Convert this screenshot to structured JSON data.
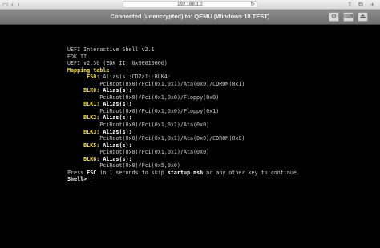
{
  "browser": {
    "url": "192.168.1.2",
    "icons": [
      "sidebar-icon",
      "back-icon",
      "forward-icon",
      "reload-icon",
      "share-icon",
      "tabs-icon"
    ]
  },
  "vnc": {
    "title": "Connected (unencrypted) to: QEMU (Windows 10 TEST)"
  },
  "console": {
    "line1": "UEFI Interactive Shell v2.1",
    "line2": "EDK II",
    "line3": "UEFI v2.50 (EDK II, 0x00010000)",
    "mapping_title": "Mapping table",
    "fs0_id": "FS0:",
    "fs0_alias": "Alias(s):CD7a1::BLK4:",
    "fs0_path": "PciRoot(0x0)/Pci(0x1,0x1)/Ata(0x0)/CDROM(0x1)",
    "blk0_id": "BLK0:",
    "blk0_alias": "Alias(s):",
    "blk0_path": "PciRoot(0x0)/Pci(0x1,0x0)/Floppy(0x0)",
    "blk1_id": "BLK1:",
    "blk1_alias": "Alias(s):",
    "blk1_path": "PciRoot(0x0)/Pci(0x1,0x0)/Floppy(0x1)",
    "blk2_id": "BLK2:",
    "blk2_alias": "Alias(s):",
    "blk2_path": "PciRoot(0x0)/Pci(0x1,0x1)/Ata(0x0)",
    "blk3_id": "BLK3:",
    "blk3_alias": "Alias(s):",
    "blk3_path": "PciRoot(0x0)/Pci(0x1,0x1)/Ata(0x0)/CDROM(0x0)",
    "blk5_id": "BLK5:",
    "blk5_alias": "Alias(s):",
    "blk5_path": "PciRoot(0x0)/Pci(0x1,0x1)/Ata(0x0)",
    "blk6_id": "BLK6:",
    "blk6_alias": "Alias(s):",
    "blk6_path": "PciRoot(0x0)/Pci(0x5,0x0)",
    "press_pre": "Press ",
    "press_esc": "ESC",
    "press_mid": " in 1 seconds to skip ",
    "press_script": "startup.nsh",
    "press_post": " or any other key to continue.",
    "prompt": "Shell> ",
    "cursor": "_"
  }
}
